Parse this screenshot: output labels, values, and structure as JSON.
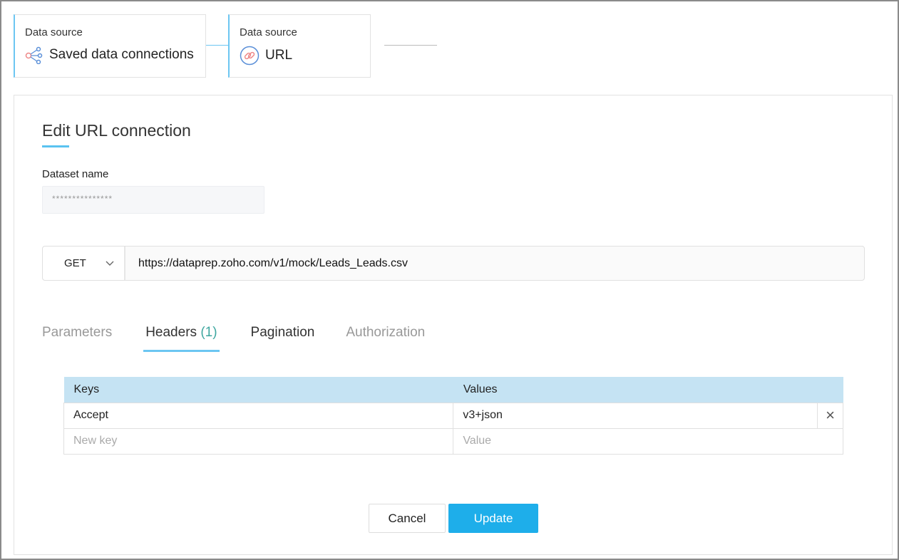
{
  "steps": [
    {
      "label": "Data source",
      "value": "Saved data connections",
      "icon": "share-icon"
    },
    {
      "label": "Data source",
      "value": "URL",
      "icon": "link-icon"
    }
  ],
  "form": {
    "title": "Edit URL connection",
    "dataset_label": "Dataset name",
    "dataset_value": "***************",
    "method": "GET",
    "url": "https://dataprep.zoho.com/v1/mock/Leads_Leads.csv"
  },
  "tabs": {
    "parameters": "Parameters",
    "headers": "Headers",
    "headers_count": "(1)",
    "pagination": "Pagination",
    "authorization": "Authorization"
  },
  "table": {
    "col_keys": "Keys",
    "col_values": "Values",
    "row_key": "Accept",
    "row_value": "v3+json",
    "new_key_placeholder": "New key",
    "new_value_placeholder": "Value"
  },
  "buttons": {
    "cancel": "Cancel",
    "update": "Update"
  }
}
